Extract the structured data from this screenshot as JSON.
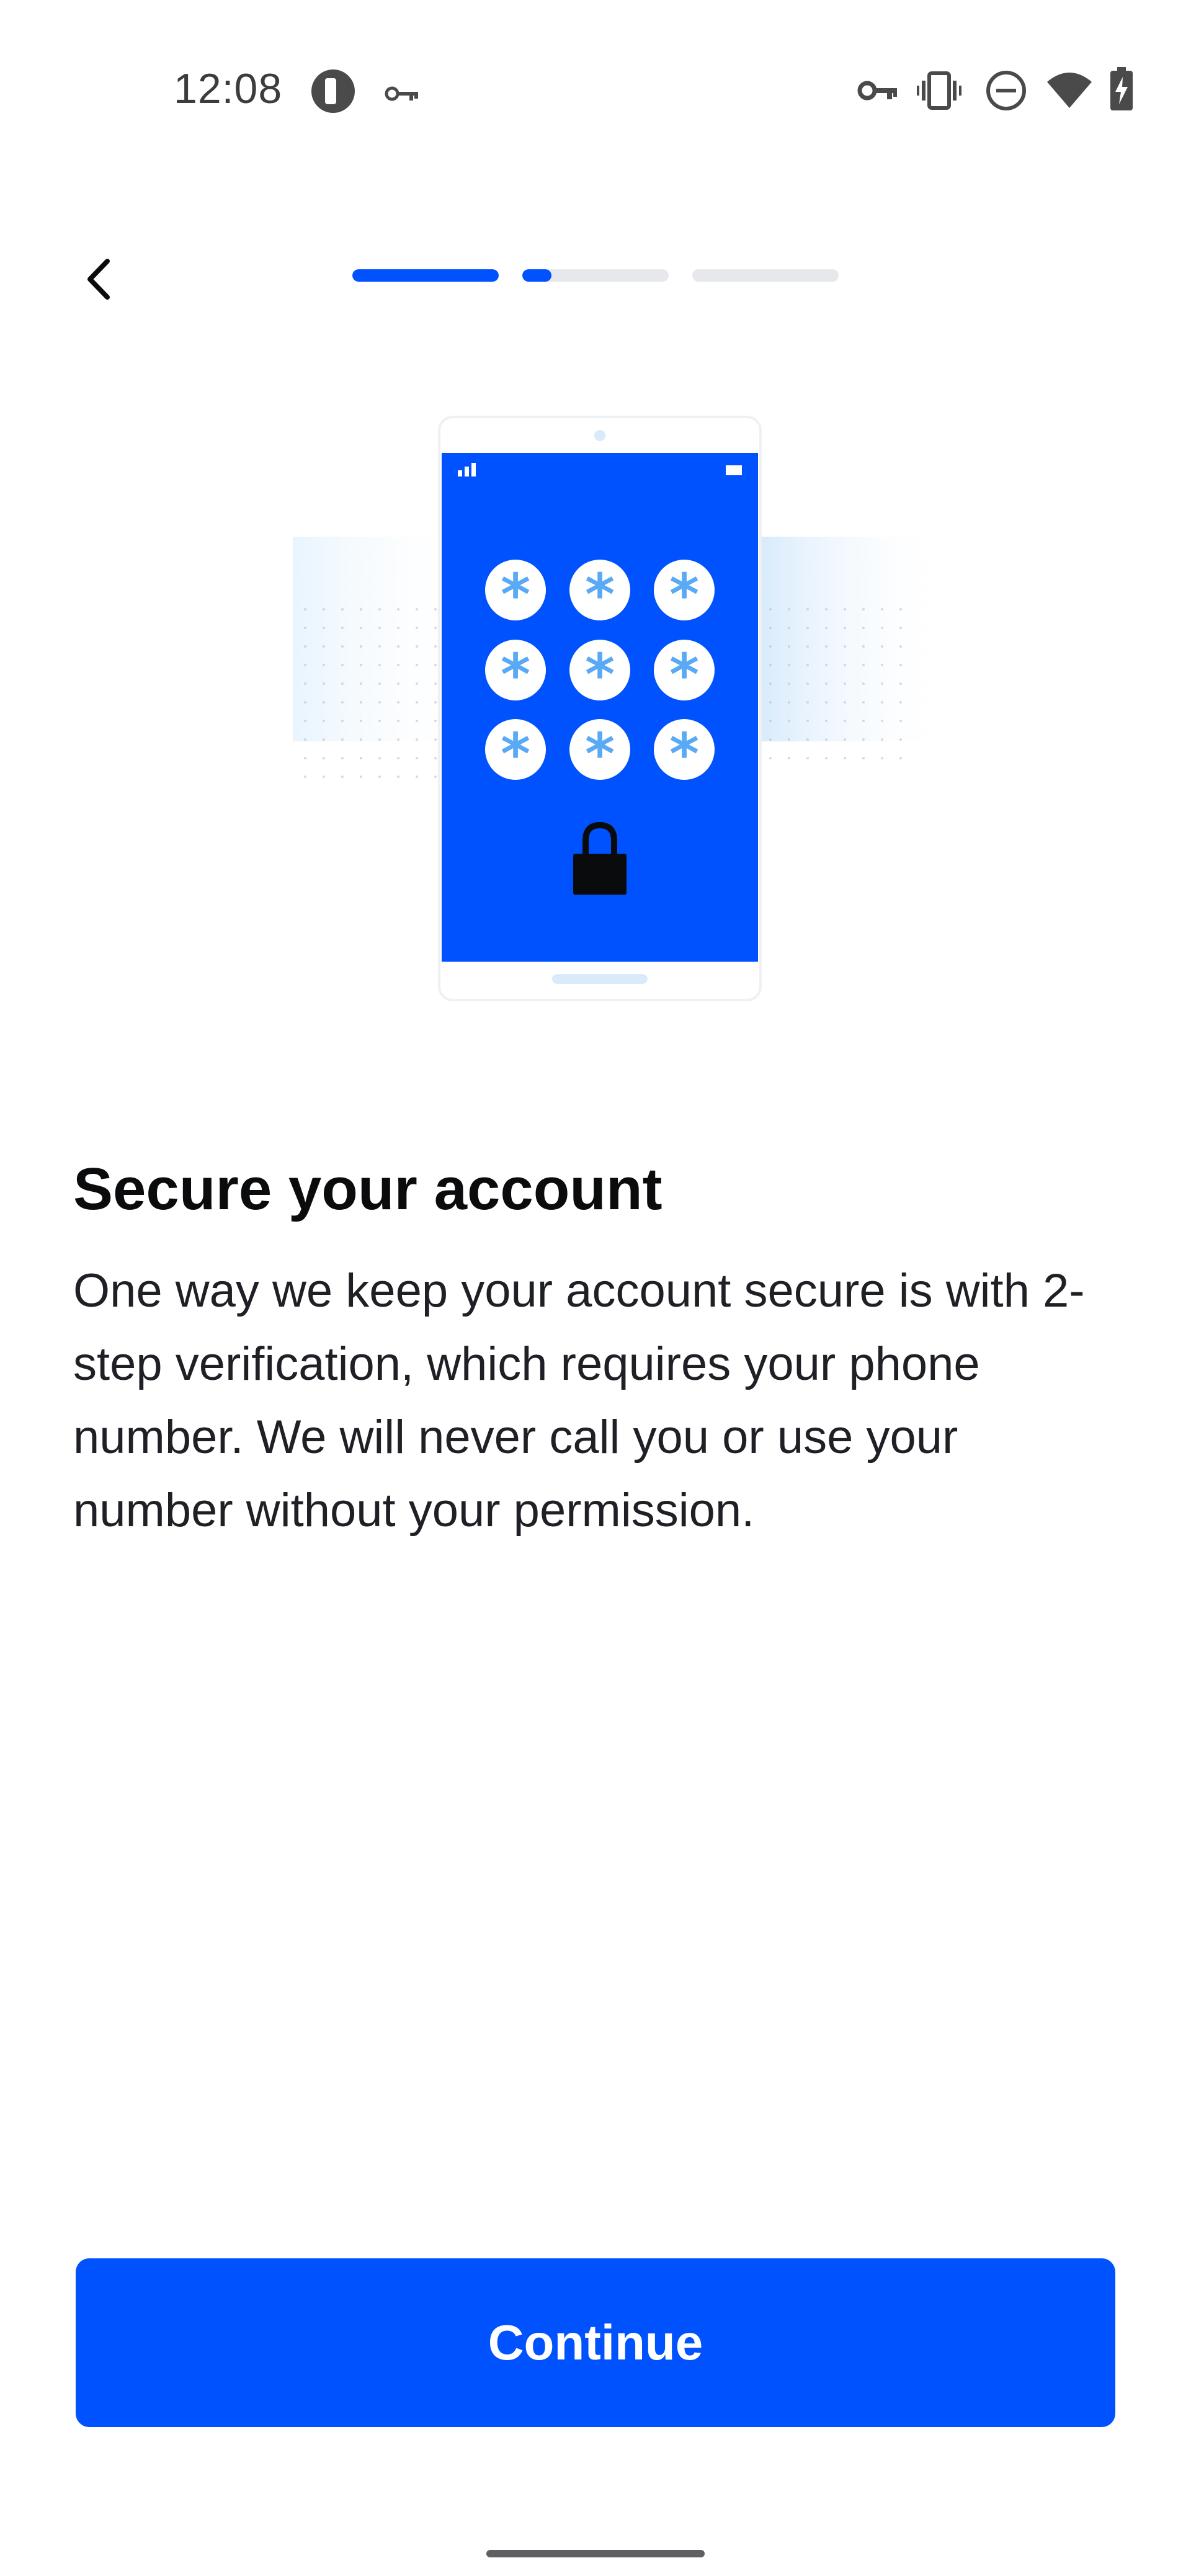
{
  "status_bar": {
    "time": "12:08",
    "icons": [
      "app-notification-icon",
      "vpn-key-icon",
      "vpn-key-icon",
      "vibrate-icon",
      "do-not-disturb-icon",
      "wifi-icon",
      "battery-charging-icon"
    ]
  },
  "header": {
    "back_icon": "chevron-left-icon",
    "progress": [
      {
        "step": 1,
        "fill": 1.0
      },
      {
        "step": 2,
        "fill": 0.2
      },
      {
        "step": 3,
        "fill": 0.0
      }
    ]
  },
  "illustration": {
    "subject": "phone-pin-lock",
    "pin_glyph": "*",
    "icons": [
      "phone-illustration",
      "asterisk-icon",
      "padlock-icon"
    ]
  },
  "content": {
    "title": "Secure your account",
    "description": "One way we keep your account secure is with 2-step verification, which requires your phone number. We will never call you or use your number without your permission."
  },
  "actions": {
    "continue_label": "Continue"
  },
  "colors": {
    "accent": "#0052ff",
    "track": "#e6e8ec",
    "text": "#0a0b0d",
    "asterisk": "#5aa9f5"
  }
}
